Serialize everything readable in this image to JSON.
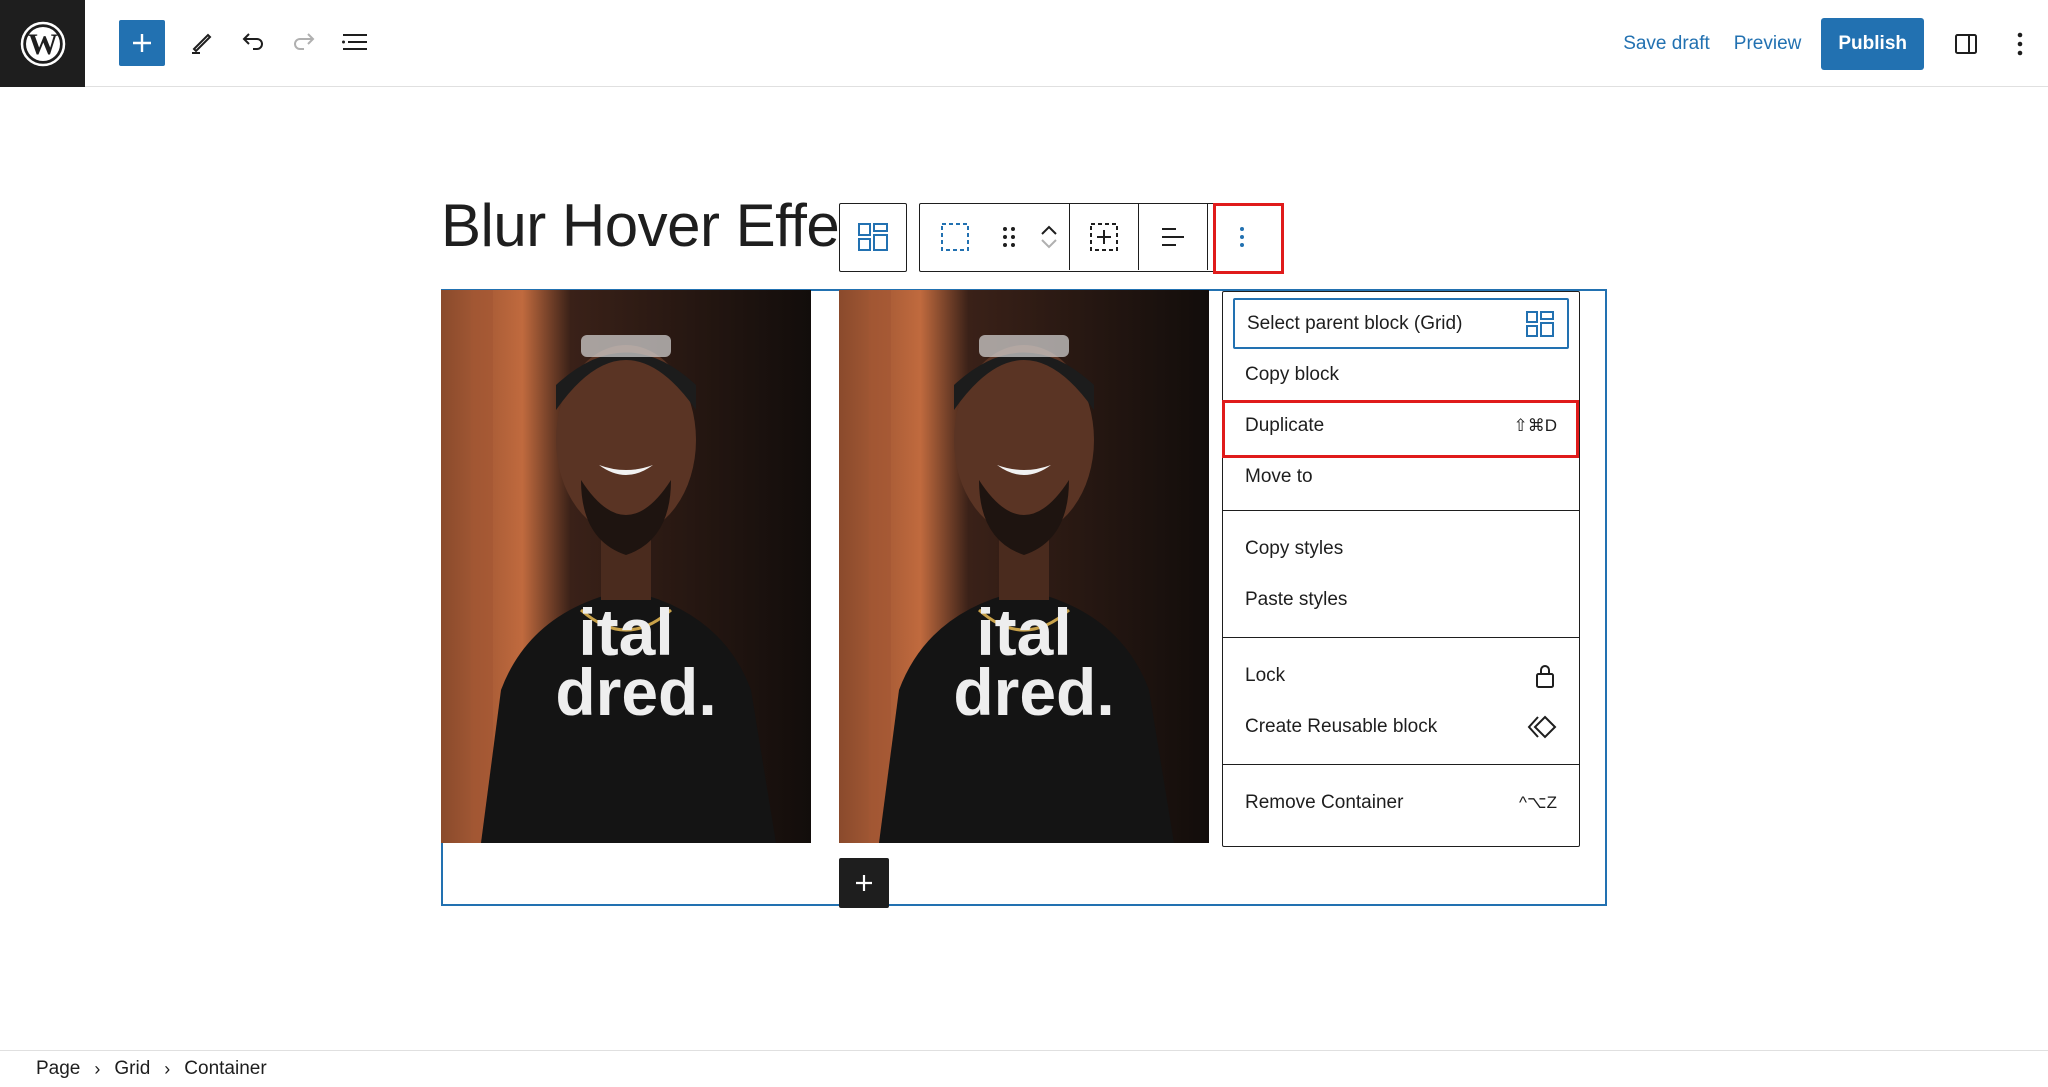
{
  "topbar": {
    "logo": "wordpress-logo",
    "save_draft": "Save draft",
    "preview": "Preview",
    "publish": "Publish"
  },
  "editor": {
    "title": "Blur Hover Effect"
  },
  "images": [
    {
      "shirt_line1": "ital",
      "shirt_line2": "dred."
    },
    {
      "shirt_line1": "ital",
      "shirt_line2": "dred."
    }
  ],
  "menu": {
    "sections": [
      [
        {
          "label": "Select parent block (Grid)",
          "icon": "grid-icon"
        },
        {
          "label": "Copy block"
        },
        {
          "label": "Duplicate",
          "shortcut": "⇧⌘D"
        },
        {
          "label": "Move to"
        }
      ],
      [
        {
          "label": "Copy styles"
        },
        {
          "label": "Paste styles"
        }
      ],
      [
        {
          "label": "Lock",
          "icon": "lock-icon"
        },
        {
          "label": "Create Reusable block",
          "icon": "reusable-block-icon"
        }
      ],
      [
        {
          "label": "Remove Container",
          "shortcut": "^⌥Z"
        }
      ]
    ]
  },
  "breadcrumb": [
    "Page",
    "Grid",
    "Container"
  ],
  "colors": {
    "accent": "#2271b1",
    "highlight": "#e01b1b",
    "dark": "#1e1e1e"
  }
}
